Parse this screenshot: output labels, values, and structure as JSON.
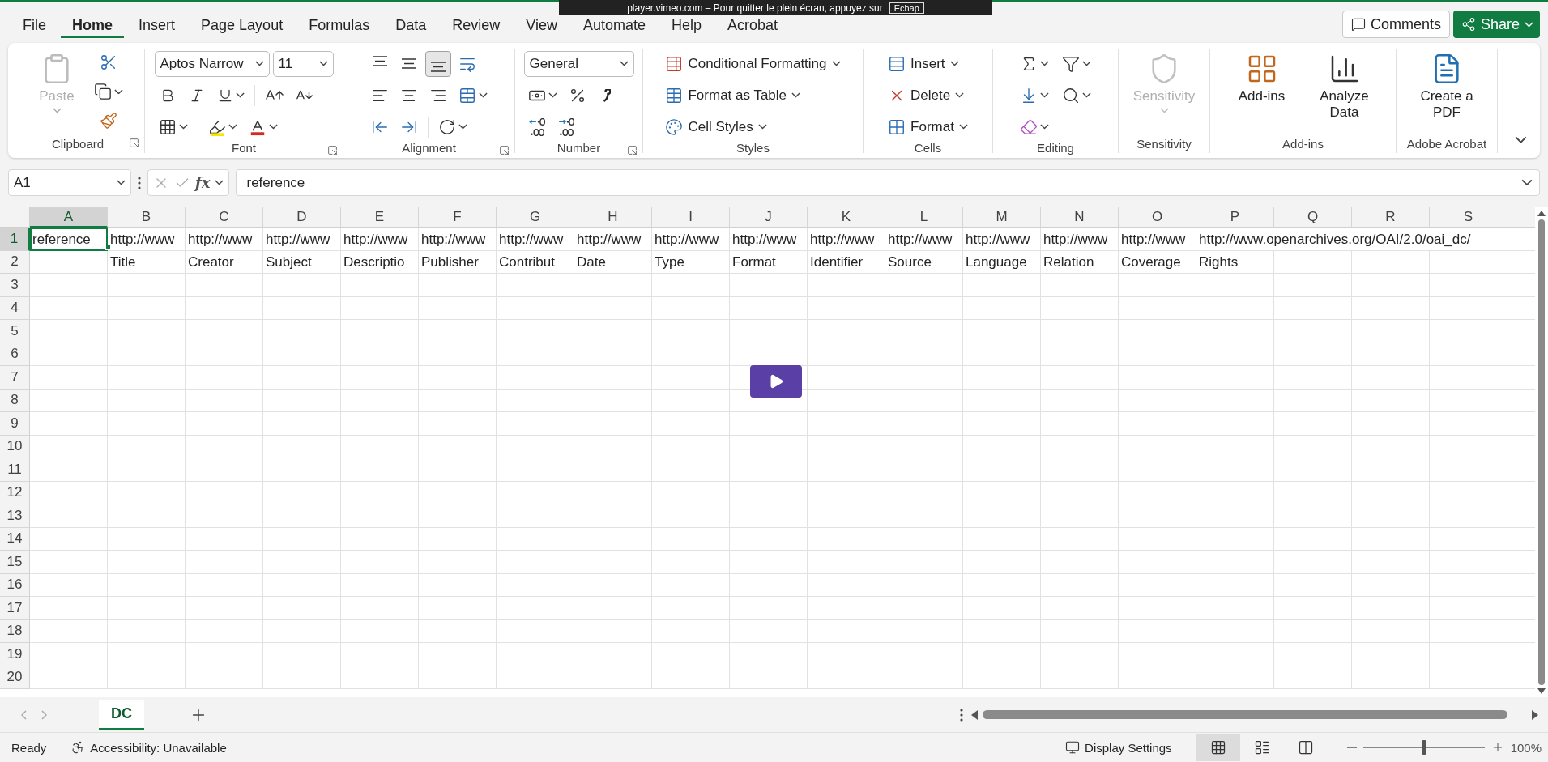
{
  "notification": {
    "text": "player.vimeo.com – Pour quitter le plein écran, appuyez sur",
    "key": "Echap"
  },
  "menu": {
    "tabs": [
      {
        "label": "File",
        "selected": false
      },
      {
        "label": "Home",
        "selected": true
      },
      {
        "label": "Insert",
        "selected": false
      },
      {
        "label": "Page Layout",
        "selected": false
      },
      {
        "label": "Formulas",
        "selected": false
      },
      {
        "label": "Data",
        "selected": false
      },
      {
        "label": "Review",
        "selected": false
      },
      {
        "label": "View",
        "selected": false
      },
      {
        "label": "Automate",
        "selected": false
      },
      {
        "label": "Help",
        "selected": false
      },
      {
        "label": "Acrobat",
        "selected": false
      }
    ],
    "comments": "Comments",
    "share": "Share"
  },
  "ribbon": {
    "groups": [
      {
        "kind": "clipboard",
        "label": "Clipboard",
        "launcher": true,
        "paste": {
          "label": "Paste",
          "disabled": true
        }
      },
      {
        "kind": "font",
        "label": "Font",
        "launcher": true,
        "font_name": "Aptos Narrow",
        "font_size": "11"
      },
      {
        "kind": "alignment",
        "label": "Alignment",
        "launcher": true,
        "vertical": [
          {
            "selected": false
          },
          {
            "selected": false
          },
          {
            "selected": true
          }
        ]
      },
      {
        "kind": "number",
        "label": "Number",
        "launcher": true,
        "format": "General"
      },
      {
        "kind": "styles",
        "label": "Styles",
        "commands": [
          "Conditional Formatting",
          "Format as Table",
          "Cell Styles"
        ]
      },
      {
        "kind": "cells",
        "label": "Cells",
        "commands": [
          "Insert",
          "Delete",
          "Format"
        ]
      },
      {
        "kind": "editing",
        "label": "Editing"
      },
      {
        "kind": "sensitivity",
        "label": "Sensitivity",
        "buttons": [
          {
            "label": "Sensitivity",
            "disabled": true
          }
        ]
      },
      {
        "kind": "addins",
        "label": "Add-ins",
        "buttons": [
          {
            "label": "Add-ins",
            "disabled": false
          },
          {
            "label": "Analyze Data",
            "disabled": false
          }
        ]
      },
      {
        "kind": "acrobat",
        "label": "Adobe Acrobat",
        "buttons": [
          {
            "label": "Create a PDF",
            "disabled": false
          }
        ]
      }
    ]
  },
  "formula_bar": {
    "name_box": "A1",
    "fx": "fx",
    "value": "reference"
  },
  "sheet": {
    "columns": [
      {
        "label": "A",
        "selected": true
      },
      {
        "label": "B",
        "selected": false
      },
      {
        "label": "C",
        "selected": false
      },
      {
        "label": "D",
        "selected": false
      },
      {
        "label": "E",
        "selected": false
      },
      {
        "label": "F",
        "selected": false
      },
      {
        "label": "G",
        "selected": false
      },
      {
        "label": "H",
        "selected": false
      },
      {
        "label": "I",
        "selected": false
      },
      {
        "label": "J",
        "selected": false
      },
      {
        "label": "K",
        "selected": false
      },
      {
        "label": "L",
        "selected": false
      },
      {
        "label": "M",
        "selected": false
      },
      {
        "label": "N",
        "selected": false
      },
      {
        "label": "O",
        "selected": false
      },
      {
        "label": "P",
        "selected": false
      },
      {
        "label": "Q",
        "selected": false
      },
      {
        "label": "R",
        "selected": false
      },
      {
        "label": "S",
        "selected": false
      }
    ],
    "rows": [
      {
        "label": "1",
        "selected": true,
        "cells": [
          {
            "text": "reference",
            "selected": true
          },
          {
            "text": "http://www",
            "selected": false
          },
          {
            "text": "http://www",
            "selected": false
          },
          {
            "text": "http://www",
            "selected": false
          },
          {
            "text": "http://www",
            "selected": false
          },
          {
            "text": "http://www",
            "selected": false
          },
          {
            "text": "http://www",
            "selected": false
          },
          {
            "text": "http://www",
            "selected": false
          },
          {
            "text": "http://www",
            "selected": false
          },
          {
            "text": "http://www",
            "selected": false
          },
          {
            "text": "http://www",
            "selected": false
          },
          {
            "text": "http://www",
            "selected": false
          },
          {
            "text": "http://www",
            "selected": false
          },
          {
            "text": "http://www",
            "selected": false
          },
          {
            "text": "http://www",
            "selected": false
          },
          {
            "text": "http://www.openarchives.org/OAI/2.0/oai_dc/",
            "selected": false
          }
        ]
      },
      {
        "label": "2",
        "selected": false,
        "cells": [
          {
            "selected": false
          },
          {
            "text": "Title",
            "selected": false
          },
          {
            "text": "Creator",
            "selected": false
          },
          {
            "text": "Subject",
            "selected": false
          },
          {
            "text": "Descriptio",
            "selected": false
          },
          {
            "text": "Publisher",
            "selected": false
          },
          {
            "text": "Contribut",
            "selected": false
          },
          {
            "text": "Date",
            "selected": false
          },
          {
            "text": "Type",
            "selected": false
          },
          {
            "text": "Format",
            "selected": false
          },
          {
            "text": "Identifier",
            "selected": false
          },
          {
            "text": "Source",
            "selected": false
          },
          {
            "text": "Language",
            "selected": false
          },
          {
            "text": "Relation",
            "selected": false
          },
          {
            "text": "Coverage",
            "selected": false
          },
          {
            "text": "Rights",
            "selected": false
          }
        ]
      },
      {
        "label": "3",
        "selected": false
      },
      {
        "label": "4",
        "selected": false
      },
      {
        "label": "5",
        "selected": false
      },
      {
        "label": "6",
        "selected": false
      },
      {
        "label": "7",
        "selected": false
      },
      {
        "label": "8",
        "selected": false
      },
      {
        "label": "9",
        "selected": false
      },
      {
        "label": "10",
        "selected": false
      },
      {
        "label": "11",
        "selected": false
      },
      {
        "label": "12",
        "selected": false
      },
      {
        "label": "13",
        "selected": false
      },
      {
        "label": "14",
        "selected": false
      },
      {
        "label": "15",
        "selected": false
      },
      {
        "label": "16",
        "selected": false
      },
      {
        "label": "17",
        "selected": false
      },
      {
        "label": "18",
        "selected": false
      },
      {
        "label": "19",
        "selected": false
      },
      {
        "label": "20",
        "selected": false
      }
    ]
  },
  "sheet_tabs": [
    {
      "label": "DC",
      "selected": true
    }
  ],
  "status_bar": {
    "ready": "Ready",
    "accessibility": "Accessibility: Unavailable",
    "display_settings": "Display Settings",
    "views": [
      {
        "kind": "normal",
        "selected": true
      },
      {
        "kind": "page_layout",
        "selected": false
      },
      {
        "kind": "page_break",
        "selected": false
      }
    ],
    "zoom": {
      "level": 0.5,
      "reading": "100%"
    }
  }
}
